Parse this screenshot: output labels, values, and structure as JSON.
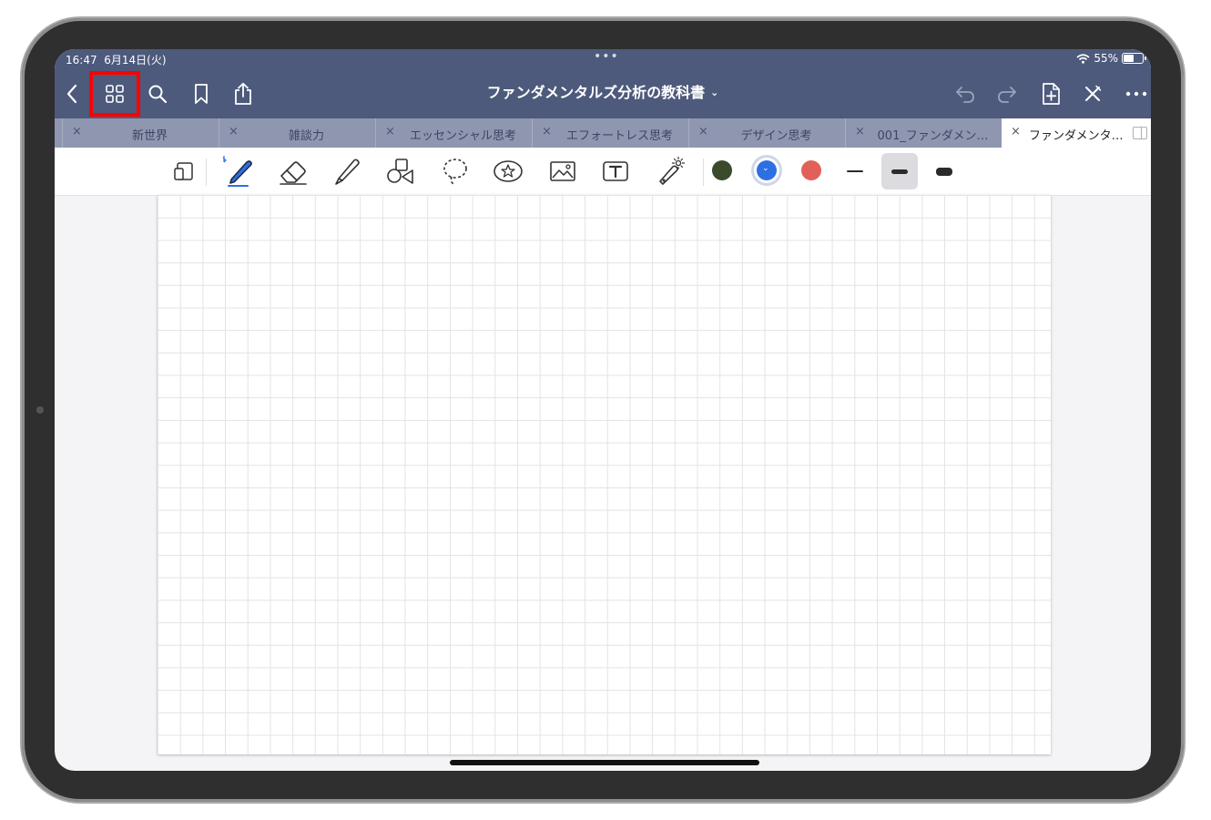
{
  "status_bar": {
    "time": "16:47",
    "date": "6月14日(火)",
    "multitask_dots": "•••",
    "battery_text": "55%",
    "battery_level": 0.55
  },
  "nav": {
    "title": "ファンダメンタルズ分析の教科書",
    "title_chevron": "⌄",
    "icons": [
      "back-chevron-icon",
      "grid-view-icon",
      "search-icon",
      "bookmark-icon",
      "share-icon",
      "undo-icon",
      "redo-icon",
      "add-page-icon",
      "close-pen-icon",
      "more-icon"
    ],
    "highlight_color": "#ff0000"
  },
  "tabs": [
    {
      "label": "新世界",
      "close": "×",
      "active": false
    },
    {
      "label": "雑談力",
      "close": "×",
      "active": false
    },
    {
      "label": "エッセンシャル思考",
      "close": "×",
      "active": false
    },
    {
      "label": "エフォートレス思考",
      "close": "×",
      "active": false
    },
    {
      "label": "デザイン思考",
      "close": "×",
      "active": false
    },
    {
      "label": "001_ファンダメン…",
      "close": "×",
      "active": false
    },
    {
      "label": "ファンダメンタ…",
      "close": "×",
      "active": true
    }
  ],
  "toolbar": {
    "tools": [
      "page-layout-icon",
      "pen-icon",
      "eraser-icon",
      "highlighter-icon",
      "shapes-icon",
      "lasso-icon",
      "sticker-icon",
      "image-icon",
      "text-icon",
      "laser-pointer-icon"
    ],
    "colors": [
      {
        "name": "dark-green",
        "hex": "#3b4a2b",
        "selected": false
      },
      {
        "name": "blue",
        "hex": "#2f6fe4",
        "selected": true
      },
      {
        "name": "red",
        "hex": "#e2605a",
        "selected": false
      }
    ],
    "strokes": [
      "thin",
      "medium",
      "thick"
    ],
    "selected_stroke": "medium"
  },
  "colors": {
    "nav_bg": "#4d5a7c",
    "tab_bar_bg": "#8f97b0",
    "grid_line": "#e3e3e3"
  }
}
